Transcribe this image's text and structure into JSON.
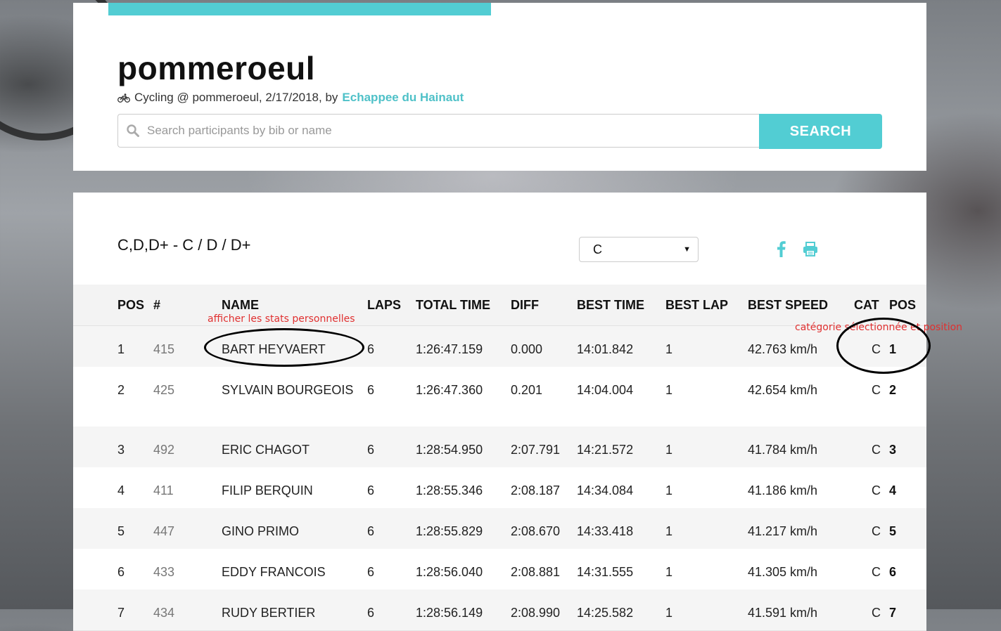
{
  "event": {
    "title": "pommeroeul",
    "subtitle_prefix": "Cycling @ pommeroeul, 2/17/2018, by",
    "organizer": "Echappee du Hainaut"
  },
  "search": {
    "placeholder": "Search participants by bib or name",
    "button_label": "SEARCH"
  },
  "results": {
    "race_title": "C,D,D+ - C / D / D+",
    "category_selected": "C",
    "columns": {
      "pos": "POS",
      "bib": "#",
      "name": "NAME",
      "laps": "LAPS",
      "total_time": "TOTAL TIME",
      "diff": "DIFF",
      "best_time": "BEST TIME",
      "best_lap": "BEST LAP",
      "best_speed": "BEST SPEED",
      "cat": "CAT",
      "cat_pos": "POS"
    },
    "rows": [
      {
        "pos": "1",
        "bib": "415",
        "name": "BART HEYVAERT",
        "laps": "6",
        "total": "1:26:47.159",
        "diff": "0.000",
        "best_time": "14:01.842",
        "best_lap": "1",
        "speed": "42.763 km/h",
        "cat": "C",
        "cat_pos": "1"
      },
      {
        "pos": "2",
        "bib": "425",
        "name": "SYLVAIN BOURGEOIS",
        "laps": "6",
        "total": "1:26:47.360",
        "diff": "0.201",
        "best_time": "14:04.004",
        "best_lap": "1",
        "speed": "42.654 km/h",
        "cat": "C",
        "cat_pos": "2"
      },
      {
        "pos": "3",
        "bib": "492",
        "name": "ERIC CHAGOT",
        "laps": "6",
        "total": "1:28:54.950",
        "diff": "2:07.791",
        "best_time": "14:21.572",
        "best_lap": "1",
        "speed": "41.784 km/h",
        "cat": "C",
        "cat_pos": "3"
      },
      {
        "pos": "4",
        "bib": "411",
        "name": "FILIP BERQUIN",
        "laps": "6",
        "total": "1:28:55.346",
        "diff": "2:08.187",
        "best_time": "14:34.084",
        "best_lap": "1",
        "speed": "41.186 km/h",
        "cat": "C",
        "cat_pos": "4"
      },
      {
        "pos": "5",
        "bib": "447",
        "name": "GINO PRIMO",
        "laps": "6",
        "total": "1:28:55.829",
        "diff": "2:08.670",
        "best_time": "14:33.418",
        "best_lap": "1",
        "speed": "41.217 km/h",
        "cat": "C",
        "cat_pos": "5"
      },
      {
        "pos": "6",
        "bib": "433",
        "name": "EDDY FRANCOIS",
        "laps": "6",
        "total": "1:28:56.040",
        "diff": "2:08.881",
        "best_time": "14:31.555",
        "best_lap": "1",
        "speed": "41.305 km/h",
        "cat": "C",
        "cat_pos": "6"
      },
      {
        "pos": "7",
        "bib": "434",
        "name": "RUDY BERTIER",
        "laps": "6",
        "total": "1:28:56.149",
        "diff": "2:08.990",
        "best_time": "14:25.582",
        "best_lap": "1",
        "speed": "41.591 km/h",
        "cat": "C",
        "cat_pos": "7"
      }
    ]
  },
  "annotations": {
    "name_note": "afficher les stats personnelles",
    "cat_note": "catégorie sélectionnée et position"
  },
  "colors": {
    "accent": "#52cdd3",
    "annotation": "#e03030"
  }
}
